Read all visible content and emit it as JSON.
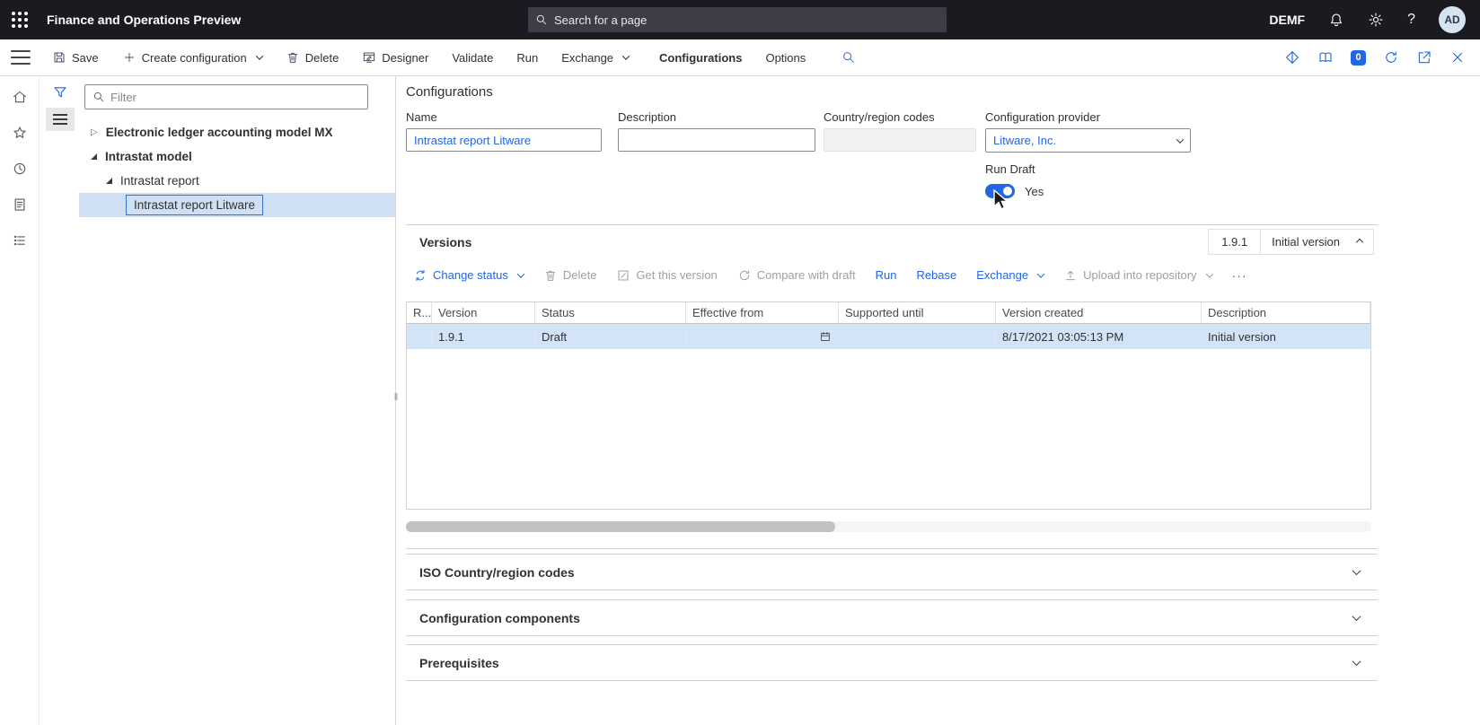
{
  "topbar": {
    "title": "Finance and Operations Preview",
    "search_placeholder": "Search for a page",
    "company": "DEMF",
    "avatar_initials": "AD",
    "help": "?"
  },
  "action_pane": {
    "save": "Save",
    "create_configuration": "Create configuration",
    "delete": "Delete",
    "designer": "Designer",
    "validate": "Validate",
    "run": "Run",
    "exchange": "Exchange",
    "tab_configurations": "Configurations",
    "tab_options": "Options",
    "badge_count": "0"
  },
  "left_panel": {
    "filter_placeholder": "Filter",
    "tree": {
      "item1": "Electronic ledger accounting model MX",
      "item2": "Intrastat model",
      "item3": "Intrastat report",
      "item4": "Intrastat report Litware"
    }
  },
  "main": {
    "page_title": "Configurations",
    "fields": {
      "name_label": "Name",
      "name_value": "Intrastat report Litware",
      "description_label": "Description",
      "country_label": "Country/region codes",
      "provider_label": "Configuration provider",
      "provider_value": "Litware, Inc.",
      "run_draft_label": "Run Draft",
      "run_draft_value": "Yes"
    },
    "versions": {
      "title": "Versions",
      "summary_version": "1.9.1",
      "summary_description": "Initial version",
      "toolbar": {
        "change_status": "Change status",
        "delete": "Delete",
        "get_this_version": "Get this version",
        "compare_with_draft": "Compare with draft",
        "run": "Run",
        "rebase": "Rebase",
        "exchange": "Exchange",
        "upload": "Upload into repository",
        "more": "···"
      },
      "grid": {
        "columns": [
          "R...",
          "Version",
          "Status",
          "Effective from",
          "Supported until",
          "Version created",
          "Description"
        ],
        "row": {
          "version": "1.9.1",
          "status": "Draft",
          "version_created": "8/17/2021 03:05:13 PM",
          "description": "Initial version"
        }
      }
    },
    "sections": {
      "iso": "ISO Country/region codes",
      "components": "Configuration components",
      "prerequisites": "Prerequisites"
    }
  },
  "colors": {
    "accent": "#2266e3",
    "topbar_bg": "#1a1a20",
    "selected_row": "#d3e3f8"
  }
}
